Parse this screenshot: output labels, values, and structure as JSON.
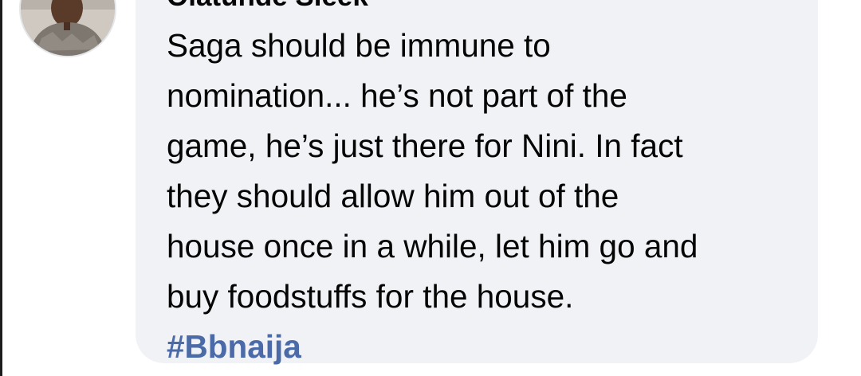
{
  "comment": {
    "author_name": "Olatunde Sleek",
    "body_lines": [
      "Saga should be immune to",
      "nomination... he’s not part of the",
      "game, he’s just there for Nini. In fact",
      "they should allow him out of the",
      "house once in a while, let him go and",
      "buy foodstuffs for the house."
    ],
    "hashtag": "#Bbnaija"
  },
  "colors": {
    "bubble_background": "#f0f2f5",
    "text": "#050505",
    "hashtag": "#4b6aa8"
  }
}
